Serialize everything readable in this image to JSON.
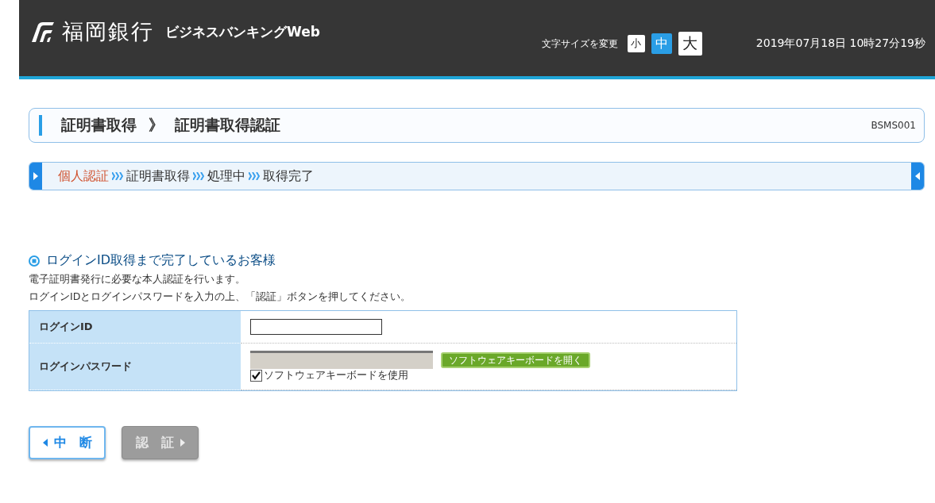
{
  "header": {
    "bank_name": "福岡銀行",
    "service_name": "ビジネスバンキングWeb",
    "font_size_label": "文字サイズを変更",
    "font_sizes": [
      {
        "label": "小",
        "selected": false
      },
      {
        "label": "中",
        "selected": true
      },
      {
        "label": "大",
        "selected": false
      }
    ],
    "datetime": "2019年07月18日 10時27分19秒"
  },
  "title_bar": {
    "crumbs": [
      "証明書取得",
      "証明書取得認証"
    ],
    "separator": "》",
    "screen_id": "BSMS001"
  },
  "steps": [
    {
      "label": "個人認証",
      "selected": true
    },
    {
      "label": "証明書取得",
      "selected": false
    },
    {
      "label": "処理中",
      "selected": false
    },
    {
      "label": "取得完了",
      "selected": false
    }
  ],
  "section": {
    "heading": "ログインID取得まで完了しているお客様",
    "lines": [
      "電子証明書発行に必要な本人認証を行います。",
      "ログインIDとログインパスワードを入力の上、「認証」ボタンを押してください。"
    ]
  },
  "form": {
    "login_id": {
      "label": "ログインID"
    },
    "password": {
      "label": "ログインパスワード",
      "disabled": true,
      "keyboard_button": "ソフトウェアキーボードを開く",
      "checkbox_label": "ソフトウェアキーボードを使用",
      "checked": true
    }
  },
  "buttons": [
    {
      "label": "中　断",
      "kind": "back",
      "disabled": false
    },
    {
      "label": "認　証",
      "kind": "next",
      "disabled": true
    }
  ]
}
